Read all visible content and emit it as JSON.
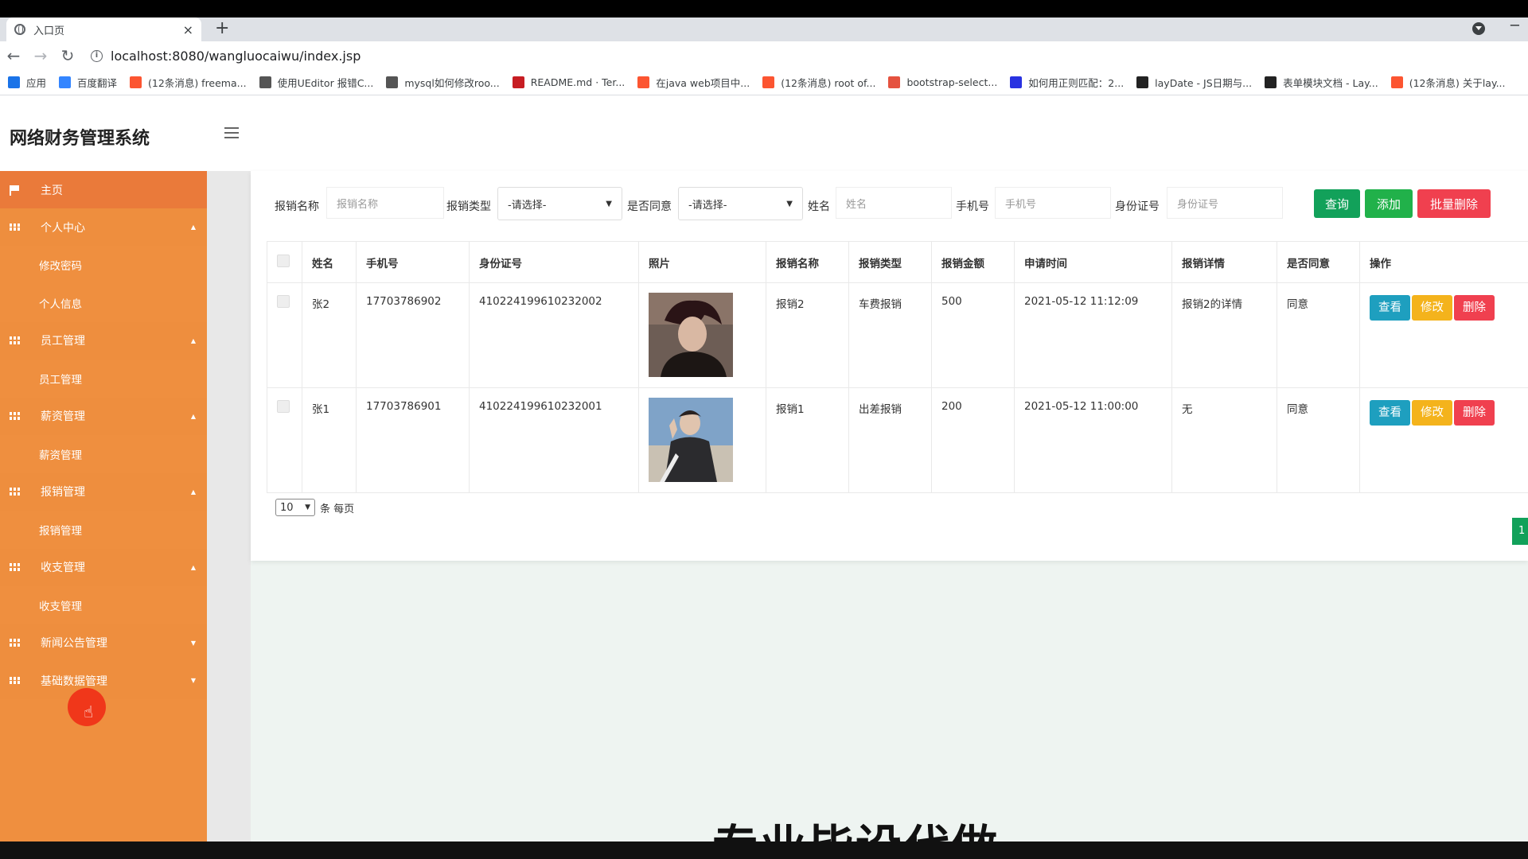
{
  "browser": {
    "tab_title": "入口页",
    "tab_close": "×",
    "new_tab": "+",
    "url": "localhost:8080/wangluocaiwu/index.jsp",
    "bookmarks": [
      {
        "label": "应用",
        "icon": "apps-grid-icon",
        "color": "#1a73e8"
      },
      {
        "label": "百度翻译",
        "icon": "baidu-translate-icon",
        "color": "#3385ff"
      },
      {
        "label": "(12条消息) freema...",
        "icon": "csdn-icon",
        "color": "#fc5531"
      },
      {
        "label": "使用UEditor 报错C...",
        "icon": "wave-icon",
        "color": "#555555"
      },
      {
        "label": "mysql如何修改roo...",
        "icon": "wave-icon",
        "color": "#555555"
      },
      {
        "label": "README.md · Ter...",
        "icon": "gitee-icon",
        "color": "#c71d23"
      },
      {
        "label": "在java web项目中...",
        "icon": "csdn-icon",
        "color": "#fc5531"
      },
      {
        "label": "(12条消息) root of...",
        "icon": "csdn-icon",
        "color": "#fc5531"
      },
      {
        "label": "bootstrap-select...",
        "icon": "cnblogs-icon",
        "color": "#e5523f"
      },
      {
        "label": "如何用正则匹配：2...",
        "icon": "baidu-paw-icon",
        "color": "#2932e1"
      },
      {
        "label": "layDate - JS日期与...",
        "icon": "layui-icon",
        "color": "#222222"
      },
      {
        "label": "表单模块文档 - Lay...",
        "icon": "layui-icon",
        "color": "#222222"
      },
      {
        "label": "(12条消息) 关于lay...",
        "icon": "csdn-icon",
        "color": "#fc5531"
      }
    ]
  },
  "app": {
    "title": "网络财务管理系统",
    "accent": "#ef8f3f"
  },
  "sidebar": {
    "home": "主页",
    "items": [
      {
        "label": "个人中心",
        "kind": "parent"
      },
      {
        "label": "修改密码",
        "kind": "child"
      },
      {
        "label": "个人信息",
        "kind": "child"
      },
      {
        "label": "员工管理",
        "kind": "parent"
      },
      {
        "label": "员工管理",
        "kind": "child"
      },
      {
        "label": "薪资管理",
        "kind": "parent"
      },
      {
        "label": "薪资管理",
        "kind": "child"
      },
      {
        "label": "报销管理",
        "kind": "parent"
      },
      {
        "label": "报销管理",
        "kind": "child"
      },
      {
        "label": "收支管理",
        "kind": "parent"
      },
      {
        "label": "收支管理",
        "kind": "child"
      },
      {
        "label": "新闻公告管理",
        "kind": "parent"
      },
      {
        "label": "基础数据管理",
        "kind": "parent"
      }
    ]
  },
  "filters": {
    "name_label": "报销名称",
    "name_placeholder": "报销名称",
    "type_label": "报销类型",
    "type_value": "-请选择-",
    "agree_label": "是否同意",
    "agree_value": "-请选择-",
    "person_label": "姓名",
    "person_placeholder": "姓名",
    "phone_label": "手机号",
    "phone_placeholder": "手机号",
    "id_label": "身份证号",
    "id_placeholder": "身份证号",
    "search_btn": "查询",
    "add_btn": "添加",
    "batch_delete_btn": "批量删除"
  },
  "table": {
    "headers": [
      "姓名",
      "手机号",
      "身份证号",
      "照片",
      "报销名称",
      "报销类型",
      "报销金额",
      "申请时间",
      "报销详情",
      "是否同意",
      "操作"
    ],
    "rows": [
      {
        "name": "张2",
        "phone": "17703786902",
        "idcard": "410224199610232002",
        "title": "报销2",
        "type": "车费报销",
        "amount": "500",
        "time": "2021-05-12 11:12:09",
        "detail": "报销2的详情",
        "agree": "同意"
      },
      {
        "name": "张1",
        "phone": "17703786901",
        "idcard": "410224199610232001",
        "title": "报销1",
        "type": "出差报销",
        "amount": "200",
        "time": "2021-05-12 11:00:00",
        "detail": "无",
        "agree": "同意"
      }
    ],
    "actions": {
      "view": "查看",
      "edit": "修改",
      "delete": "删除"
    }
  },
  "pager": {
    "page_size": "10",
    "per_page_text": "条 每页",
    "current_page": "1"
  },
  "watermark": "专业毕设代做"
}
